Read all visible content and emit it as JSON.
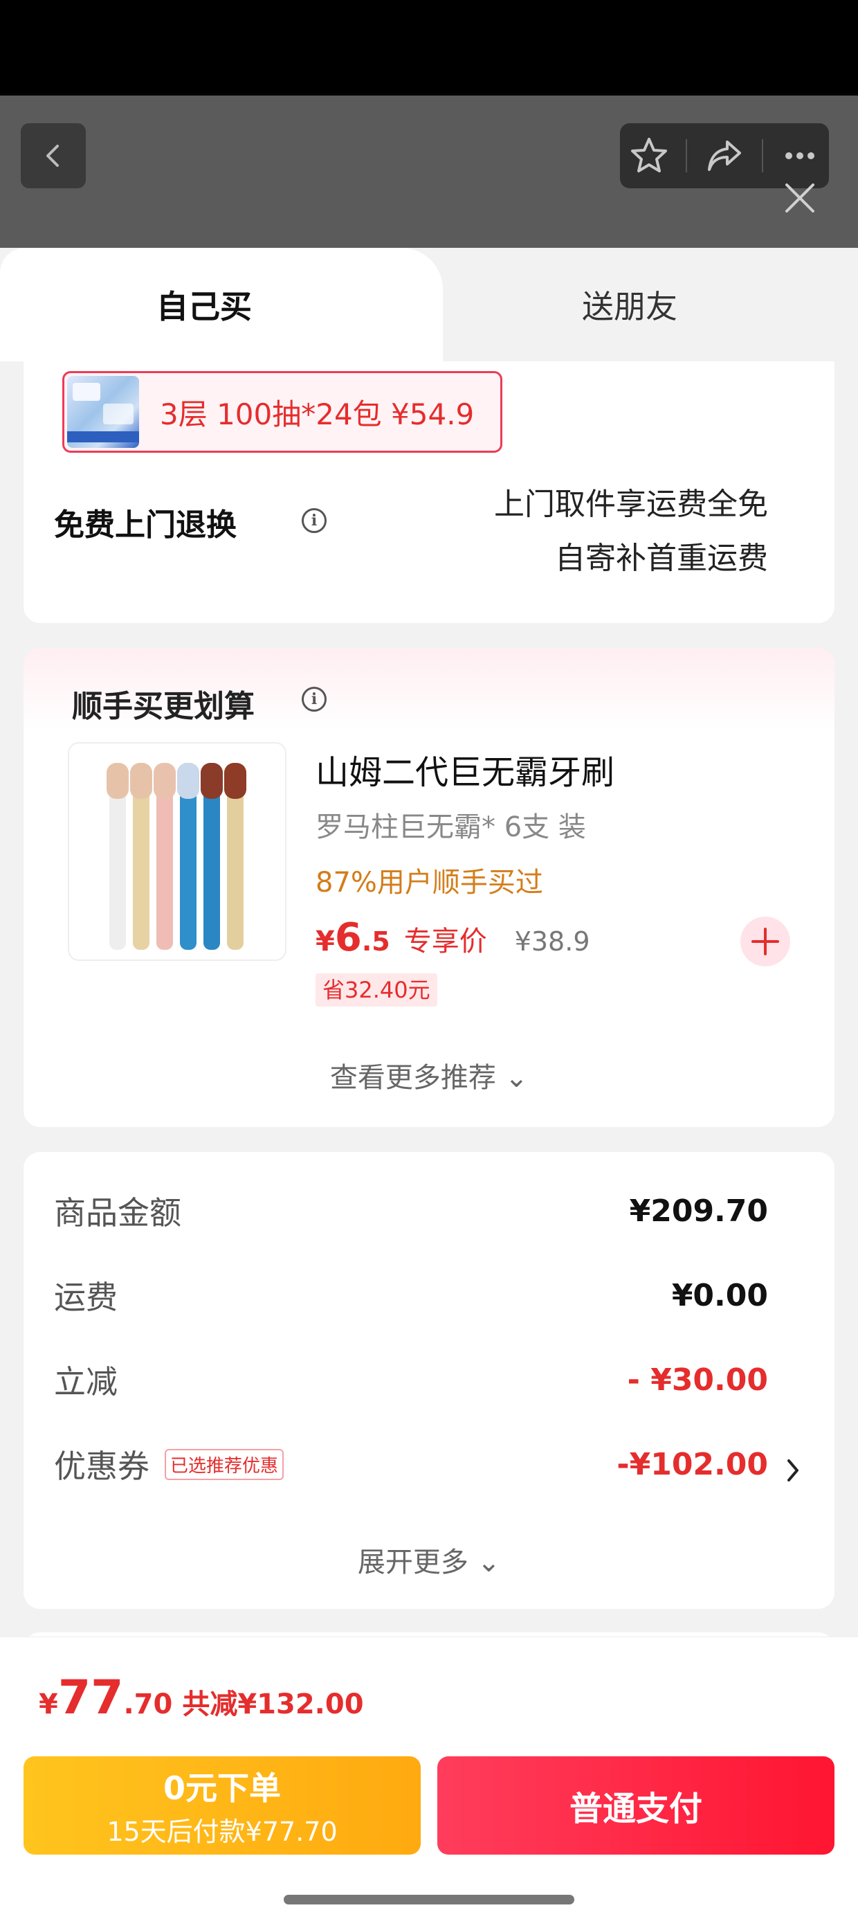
{
  "header": {
    "back_icon": "chevron-left-icon",
    "actions": [
      "star-icon",
      "share-icon",
      "more-icon"
    ],
    "close_icon": "close-icon"
  },
  "tabs": {
    "self": "自己买",
    "friend": "送朋友"
  },
  "sku": {
    "text": "3层 100抽*24包  ¥54.9"
  },
  "return": {
    "title": "免费上门退换",
    "line1": "上门取件享运费全免",
    "line2": "自寄补首重运费"
  },
  "recommend": {
    "title": "顺手买更划算",
    "product": {
      "name": "山姆二代巨无霸牙刷",
      "spec": "罗马柱巨无霸* 6支 装",
      "rate": "87%用户顺手买过",
      "price_cur": "¥",
      "price_int": "6",
      "price_dec": ".5",
      "price_tag": "专享价",
      "price_orig": "¥38.9",
      "save": "省32.40元"
    },
    "more": "查看更多推荐 ⌄"
  },
  "summary": {
    "goods_label": "商品金额",
    "goods_value": "¥209.70",
    "ship_label": "运费",
    "ship_value": "¥0.00",
    "discount_label": "立减",
    "discount_value": "- ¥30.00",
    "coupon_label": "优惠券",
    "coupon_badge": "已选推荐优惠",
    "coupon_value": "-¥102.00",
    "expand": "展开更多 ⌄"
  },
  "bottom": {
    "total_cur": "¥",
    "total_int": "77",
    "total_dec": ".70",
    "total_save": "共减¥132.00",
    "bnpl_line1": "0元下单",
    "bnpl_line2": "15天后付款¥77.70",
    "pay": "普通支付"
  },
  "colors": {
    "accent": "#e52d2d",
    "bnpl": "#ffb414",
    "pay": "#ff2441"
  }
}
